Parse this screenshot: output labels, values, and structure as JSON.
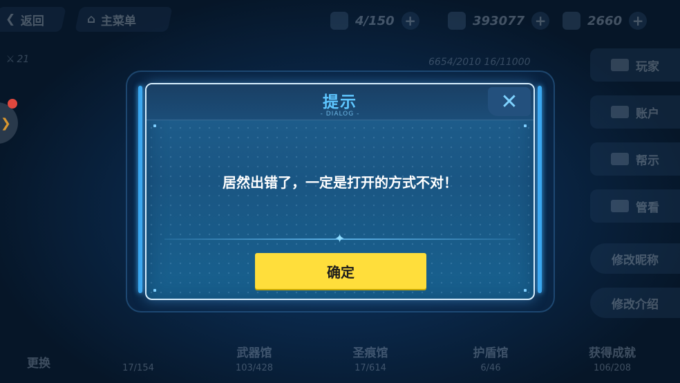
{
  "background": {
    "back_label": "返回",
    "home_label": "主菜单",
    "resources": [
      {
        "icon": "stamina-icon",
        "value": "4/150"
      },
      {
        "icon": "coin-icon",
        "value": "393077"
      },
      {
        "icon": "crystal-icon",
        "value": "2660"
      }
    ],
    "player_level": "21",
    "stats_text": "6654/2010  16/11000",
    "right_menu": [
      "玩家",
      "账户",
      "帮示",
      "管看"
    ],
    "right_buttons": [
      "修改昵称",
      "修改介绍"
    ],
    "bottom_stats": [
      {
        "title": "更换",
        "value": ""
      },
      {
        "title": "",
        "value": "17/154"
      },
      {
        "title": "武器馆",
        "value": "103/428"
      },
      {
        "title": "圣痕馆",
        "value": "17/614"
      },
      {
        "title": "护盾馆",
        "value": "6/46"
      },
      {
        "title": "获得成就",
        "value": "106/208"
      }
    ]
  },
  "dialog": {
    "title": "提示",
    "subtitle": "- DIALOG -",
    "close_symbol": "✕",
    "message": "居然出错了，一定是打开的方式不对！",
    "confirm_label": "确定"
  },
  "colors": {
    "accent": "#5ec6ff",
    "button": "#ffde3b",
    "dialog_bg": "#1a5683"
  }
}
